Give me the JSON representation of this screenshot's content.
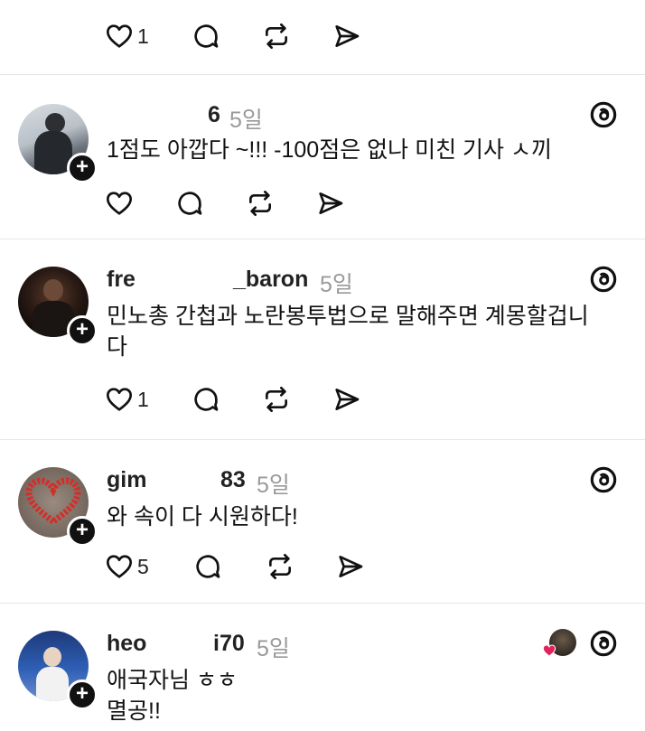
{
  "top_actions": {
    "like_count": "1"
  },
  "posts": [
    {
      "username_a": "",
      "username_b": "6",
      "time": "5일",
      "text_lines": [
        "1점도 아깝다 ~!!! -100점은 없나 미친 기사 ㅅ끼"
      ],
      "like_count": ""
    },
    {
      "username_a": "fre",
      "username_b": "_baron",
      "time": "5일",
      "text_lines": [
        "민노총 간첩과 노란봉투법으로 말해주면 계몽할겁니",
        "다"
      ],
      "like_count": "1"
    },
    {
      "username_a": "gim",
      "username_b": "83",
      "time": "5일",
      "text_lines": [
        "와 속이 다 시원하다!"
      ],
      "like_count": "5"
    },
    {
      "username_a": "heo",
      "username_b": "i70",
      "time": "5일",
      "text_lines": [
        "애국자님 ㅎㅎ",
        "멸공!!"
      ],
      "like_count": ""
    }
  ],
  "icons": {
    "like": "heart-icon",
    "reply": "comment-icon",
    "repost": "repost-icon",
    "share": "send-icon",
    "app": "threads-logo-icon",
    "follow": "plus-icon"
  },
  "colors": {
    "text": "#111111",
    "muted": "#9a9a9a",
    "divider": "#e6e6e6",
    "heart_red": "#e0245e"
  }
}
